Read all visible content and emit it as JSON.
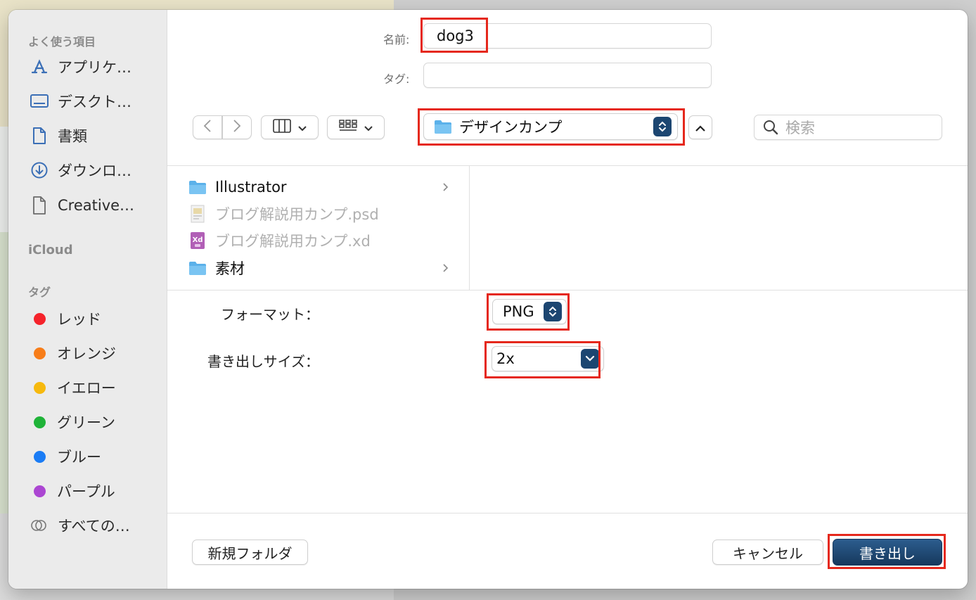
{
  "sidebar": {
    "favorites_header": "よく使う項目",
    "favorites": [
      {
        "label": "アプリケ…",
        "icon": "applications-icon"
      },
      {
        "label": "デスクト…",
        "icon": "desktop-icon"
      },
      {
        "label": "書類",
        "icon": "document-icon"
      },
      {
        "label": "ダウンロ…",
        "icon": "download-icon"
      },
      {
        "label": "Creative…",
        "icon": "document-icon"
      }
    ],
    "icloud_header": "iCloud",
    "tags_header": "タグ",
    "tags": [
      {
        "label": "レッド",
        "color": "#f5232b"
      },
      {
        "label": "オレンジ",
        "color": "#f77d19"
      },
      {
        "label": "イエロー",
        "color": "#f6b90e"
      },
      {
        "label": "グリーン",
        "color": "#1fb338"
      },
      {
        "label": "ブルー",
        "color": "#1a7cf5"
      },
      {
        "label": "パープル",
        "color": "#ab46d2"
      },
      {
        "label": "すべての…",
        "color": ""
      }
    ]
  },
  "form": {
    "name_label": "名前:",
    "name_value": "dog3",
    "tag_label": "タグ:",
    "tag_value": ""
  },
  "toolbar": {
    "location": "デザインカンプ",
    "search_placeholder": "検索"
  },
  "files": [
    {
      "name": "Illustrator",
      "type": "folder",
      "enabled": true
    },
    {
      "name": "ブログ解説用カンプ.psd",
      "type": "psd",
      "enabled": false
    },
    {
      "name": "ブログ解説用カンプ.xd",
      "type": "xd",
      "enabled": false
    },
    {
      "name": "素材",
      "type": "folder",
      "enabled": true
    }
  ],
  "options": {
    "format_label": "フォーマット：",
    "format_value": "PNG",
    "size_label": "書き出しサイズ：",
    "size_value": "2x"
  },
  "buttons": {
    "new_folder": "新規フォルダ",
    "cancel": "キャンセル",
    "export": "書き出し"
  },
  "colors": {
    "accent": "#1c4671",
    "highlight": "#e5281c"
  }
}
